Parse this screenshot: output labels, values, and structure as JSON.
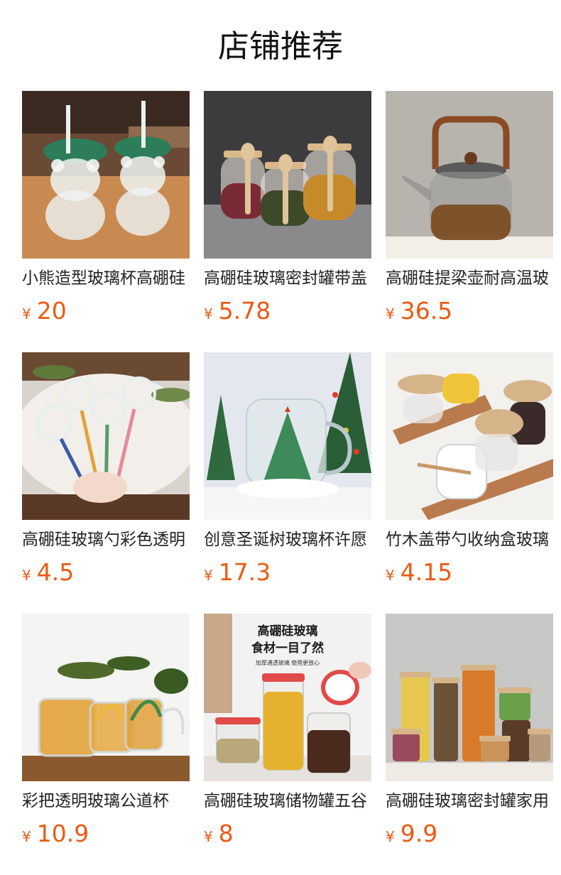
{
  "page_title": "店铺推荐",
  "currency_symbol": "¥",
  "accent_color": "#ea5a13",
  "products": [
    {
      "name": "小熊造型玻璃杯高硼硅",
      "price": "20",
      "image": "bear-shaped-glass-cups-image"
    },
    {
      "name": "高硼硅玻璃密封罐带盖",
      "price": "5.78",
      "image": "glass-storage-jars-with-spoons-image"
    },
    {
      "name": "高硼硅提梁壶耐高温玻",
      "price": "36.5",
      "image": "glass-teapot-with-handle-image"
    },
    {
      "name": "高硼硅玻璃勺彩色透明",
      "price": "4.5",
      "image": "colorful-glass-spoons-image"
    },
    {
      "name": "创意圣诞树玻璃杯许愿",
      "price": "17.3",
      "image": "christmas-tree-glass-mug-image"
    },
    {
      "name": "竹木盖带勺收纳盒玻璃",
      "price": "4.15",
      "image": "bamboo-lid-seasoning-jars-image"
    },
    {
      "name": "彩把透明玻璃公道杯",
      "price": "10.9",
      "image": "glass-pitchers-with-colored-handles-image"
    },
    {
      "name": "高硼硅玻璃储物罐五谷",
      "price": "8",
      "image": "glass-storage-canisters-image"
    },
    {
      "name": "高硼硅玻璃密封罐家用",
      "price": "9.9",
      "image": "glass-jars-with-wooden-lids-image"
    }
  ],
  "promo_image_text": {
    "headline_line1": "高硼硅玻璃",
    "headline_line2": "食材一目了然",
    "subline": "加厚通透玻璃 使用更放心"
  }
}
